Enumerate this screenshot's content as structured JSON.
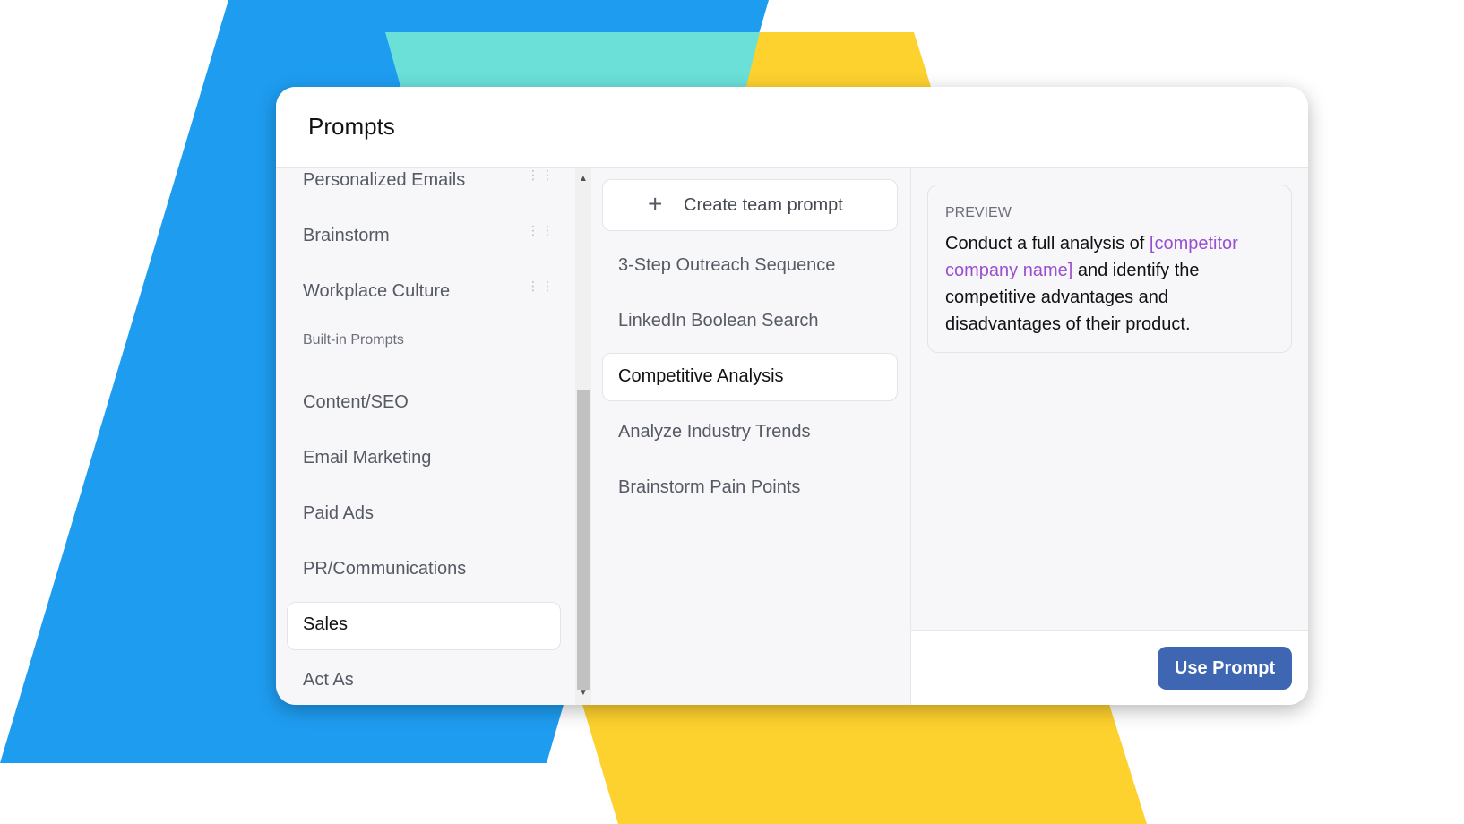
{
  "colors": {
    "blue_shape": "#1e9cf0",
    "teal_shape": "#6ae0d8",
    "yellow_shape": "#fdd12e",
    "accent_button": "#3f66b2",
    "variable_text": "#9a4fd0"
  },
  "modal": {
    "title": "Prompts"
  },
  "sidebar": {
    "items": [
      {
        "label": "Personalized Emails",
        "handle_icon": "drag-handle-icon"
      },
      {
        "label": "Brainstorm",
        "handle_icon": "drag-handle-icon"
      },
      {
        "label": "Workplace Culture",
        "handle_icon": "drag-handle-icon"
      }
    ],
    "section_label": "Built-in Prompts",
    "builtin": [
      {
        "label": "Content/SEO"
      },
      {
        "label": "Email Marketing"
      },
      {
        "label": "Paid Ads"
      },
      {
        "label": "PR/Communications"
      },
      {
        "label": "Sales",
        "active": true
      },
      {
        "label": "Act As"
      }
    ]
  },
  "prompt_list": {
    "create_label": "Create team prompt",
    "items": [
      {
        "label": "3-Step Outreach Sequence"
      },
      {
        "label": "LinkedIn Boolean Search"
      },
      {
        "label": "Competitive Analysis",
        "active": true
      },
      {
        "label": "Analyze Industry Trends"
      },
      {
        "label": "Brainstorm Pain Points"
      }
    ]
  },
  "preview": {
    "label": "PREVIEW",
    "text_before": "Conduct a full analysis of ",
    "variable": "[competitor company name]",
    "text_after": " and identify the competitive advantages and disadvantages of their product."
  },
  "footer": {
    "use_label": "Use Prompt"
  }
}
